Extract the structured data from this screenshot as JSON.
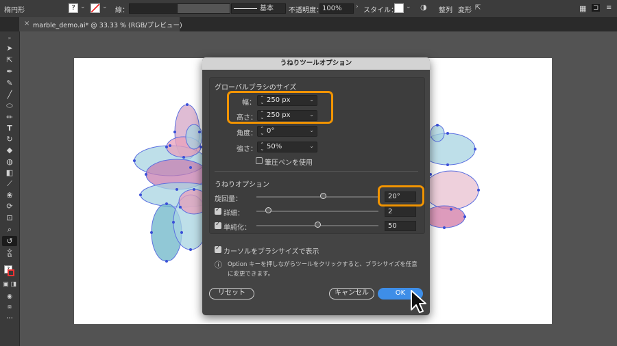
{
  "controlbar": {
    "object_type": "楕円形",
    "stroke_label": "線：",
    "brush_label": "基本",
    "opacity_label": "不透明度：",
    "opacity_value": "100%",
    "style_label": "スタイル：",
    "align_label": "整列",
    "transform_label": "変形"
  },
  "tab": {
    "close": "×",
    "title": "marble_demo.ai* @ 33.33 % (RGB/プレビュー)"
  },
  "dialog": {
    "title": "うねりツールオプション",
    "global_brush_section": "グローバルブラシのサイズ",
    "width_label": "幅：",
    "width_value": "250 px",
    "height_label": "高さ：",
    "height_value": "250 px",
    "angle_label": "角度：",
    "angle_value": "0°",
    "intensity_label": "強さ：",
    "intensity_value": "50%",
    "pressure_label": "筆圧ペンを使用",
    "twirl_section": "うねりオプション",
    "twirl_rate_label": "旋回量：",
    "twirl_rate_value": "20°",
    "detail_label": "詳細：",
    "detail_value": "2",
    "simplify_label": "単純化：",
    "simplify_value": "50",
    "show_brush_label": "カーソルをブラシサイズで表示",
    "info_icon": "ⓘ",
    "info_text_1": "Option キーを押しながらツールをクリックすると、ブラシサイズを任意",
    "info_text_2": "に変更できます。",
    "reset_label": "リセット",
    "cancel_label": "キャンセル",
    "ok_label": "OK"
  },
  "sliders": {
    "twirl_rate": 0.55,
    "detail": 0.1,
    "simplify": 0.5
  },
  "colors": {
    "accent": "#3e8ee8",
    "highlight": "#f29400",
    "pink": "#e8a0bb",
    "blue": "#a8d4e2",
    "teal": "#6cb6c8",
    "anchor": "#3a4fd8"
  }
}
